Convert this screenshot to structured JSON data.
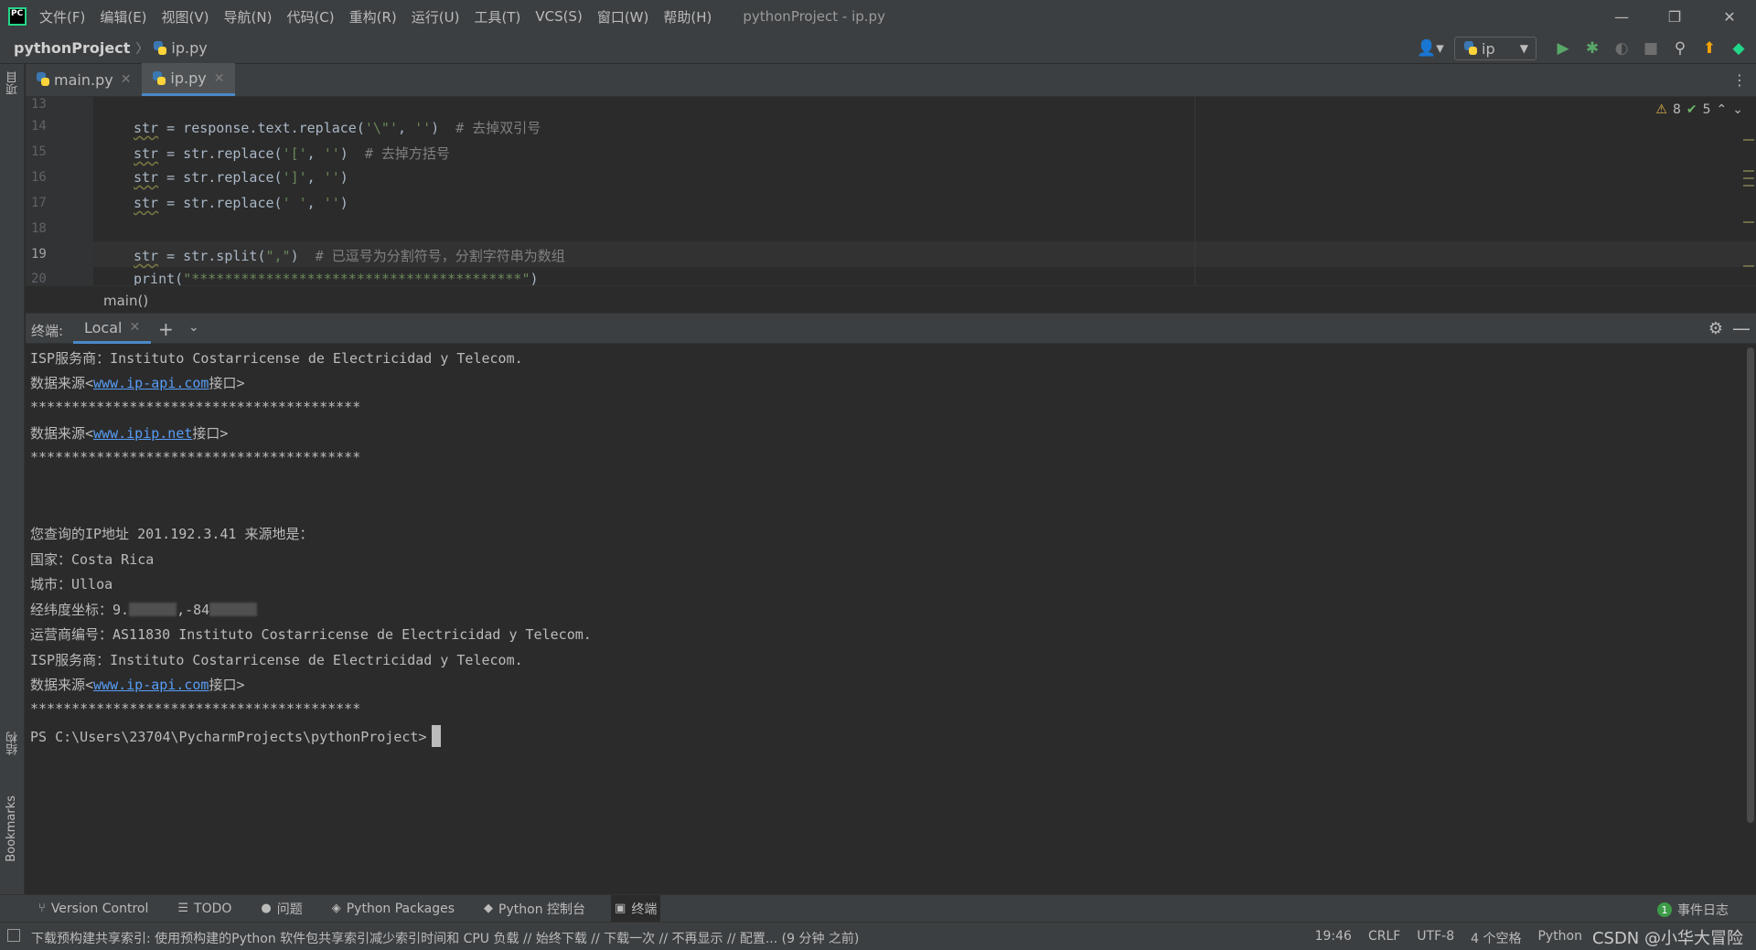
{
  "menubar": {
    "items": [
      "文件(F)",
      "编辑(E)",
      "视图(V)",
      "导航(N)",
      "代码(C)",
      "重构(R)",
      "运行(U)",
      "工具(T)",
      "VCS(S)",
      "窗口(W)",
      "帮助(H)"
    ],
    "window_title": "pythonProject - ip.py"
  },
  "navbar": {
    "project": "pythonProject",
    "separator": "〉",
    "file": "ip.py",
    "run_config": "ip"
  },
  "left_strip": {
    "project_label": "项目",
    "structure_label": "结构",
    "bookmarks_label": "Bookmarks"
  },
  "tabs": [
    {
      "label": "main.py",
      "active": false
    },
    {
      "label": "ip.py",
      "active": true
    }
  ],
  "inspections": {
    "warnings": "8",
    "ok": "5"
  },
  "editor": {
    "lines": [
      {
        "num": "13"
      },
      {
        "num": "14",
        "var": "str",
        "rest": " = response.text.replace(",
        "s1": "'\\\"'",
        "mid": ", ",
        "s2": "''",
        "end": ")  ",
        "comment": "# 去掉双引号"
      },
      {
        "num": "15",
        "var": "str",
        "rest": " = str.replace(",
        "s1": "'['",
        "mid": ", ",
        "s2": "''",
        "end": ")  ",
        "comment": "# 去掉方括号"
      },
      {
        "num": "16",
        "var": "str",
        "rest": " = str.replace(",
        "s1": "']'",
        "mid": ", ",
        "s2": "''",
        "end": ")",
        "comment": ""
      },
      {
        "num": "17",
        "var": "str",
        "rest": " = str.replace(",
        "s1": "' '",
        "mid": ", ",
        "s2": "''",
        "end": ")",
        "comment": ""
      },
      {
        "num": "18"
      },
      {
        "num": "19",
        "var": "str",
        "rest": " = str.split(",
        "s1": "\",\"",
        "mid": "",
        "s2": "",
        "end": ")  ",
        "comment": "# 已逗号为分割符号，分割字符串为数组"
      },
      {
        "num": "20",
        "pre": "print(",
        "s1": "\"****************************************\"",
        "end": ")"
      }
    ],
    "breadcrumb": "main()"
  },
  "terminal": {
    "title": "终端:",
    "tab": "Local",
    "lines": {
      "l1": "ISP服务商：Instituto Costarricense de Electricidad y Telecom.",
      "l2_pre": "数据来源<",
      "l2_link": "www.ip-api.com",
      "l2_post": "接口>",
      "l3": "****************************************",
      "l4_pre": "数据来源<",
      "l4_link": "www.ipip.net",
      "l4_post": "接口>",
      "l5": "****************************************",
      "l6": "您查询的IP地址 201.192.3.41 来源地是：",
      "l7": "国家：Costa Rica",
      "l8": "城市：Ulloa",
      "l9_pre": "经纬度坐标：9.",
      "l9_mid": ",-84",
      "l10": "运营商编号：AS11830 Instituto Costarricense de Electricidad y Telecom.",
      "l11": "ISP服务商：Instituto Costarricense de Electricidad y Telecom.",
      "l12_pre": "数据来源<",
      "l12_link": "www.ip-api.com",
      "l12_post": "接口>",
      "l13": "****************************************",
      "prompt": "PS C:\\Users\\23704\\PycharmProjects\\pythonProject>"
    }
  },
  "tool_tabs": [
    {
      "label": "Version Control",
      "icon": "⑂"
    },
    {
      "label": "TODO",
      "icon": "☰"
    },
    {
      "label": "问题",
      "icon": "●"
    },
    {
      "label": "Python Packages",
      "icon": "◈"
    },
    {
      "label": "Python 控制台",
      "icon": "◆"
    },
    {
      "label": "终端",
      "icon": "▣"
    }
  ],
  "event_log": {
    "count": "1",
    "label": "事件日志"
  },
  "status": {
    "message": "下载预构建共享索引: 使用预构建的Python 软件包共享索引减少索引时间和 CPU 负载 // 始终下载 // 下载一次 // 不再显示 // 配置... (9 分钟 之前)",
    "position": "19:46",
    "line_sep": "CRLF",
    "encoding": "UTF-8",
    "indent": "4 个空格",
    "interpreter": "Python"
  },
  "watermark": "CSDN @小华大冒险",
  "colors": {
    "accent": "#4a88c7",
    "link": "#589df6",
    "string": "#6a8759",
    "comment": "#808080"
  }
}
